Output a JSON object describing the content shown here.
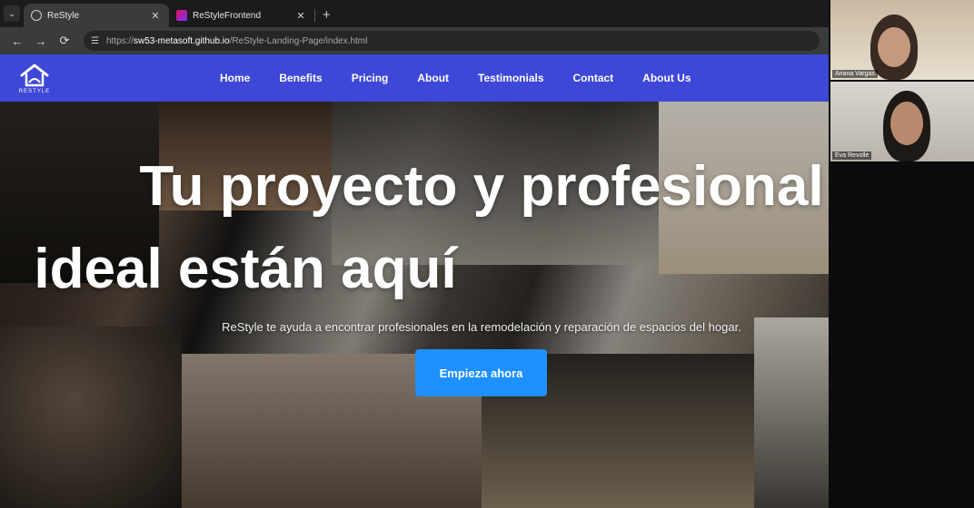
{
  "browser": {
    "tabs": [
      {
        "title": "ReStyle",
        "favicon": "globe-icon",
        "active": true
      },
      {
        "title": "ReStyleFrontend",
        "favicon": "angular-icon",
        "active": false
      }
    ],
    "close_glyph": "✕",
    "new_tab_glyph": "+",
    "url": {
      "scheme": "https://",
      "host": "sw53-metasoft.github.io",
      "path": "/ReStyle-Landing-Page/index.html"
    }
  },
  "site": {
    "logo_text": "RESTYLE",
    "nav": [
      "Home",
      "Benefits",
      "Pricing",
      "About",
      "Testimonials",
      "Contact",
      "About Us"
    ],
    "brand_color": "#3d47d8"
  },
  "hero": {
    "headline_line1": "Tu proyecto y profesional",
    "headline_line2": "ideal están aquí",
    "subtitle": "ReStyle te ayuda a encontrar profesionales en la remodelación y reparación de espacios del hogar.",
    "cta_label": "Empieza ahora",
    "cta_color": "#1e90ff"
  },
  "video_call": {
    "participants": [
      {
        "name": "Ariana Vargas"
      },
      {
        "name": "Eva Revolle"
      }
    ]
  }
}
